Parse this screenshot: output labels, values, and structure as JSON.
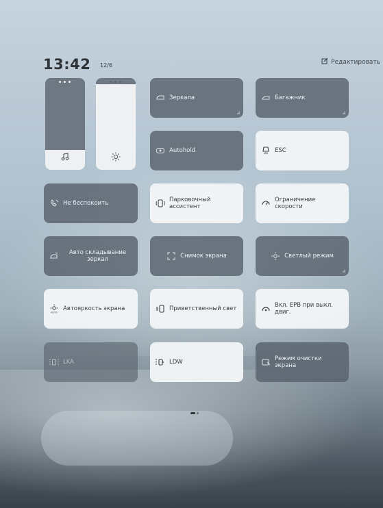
{
  "status": {
    "time": "13:42",
    "date": "12/6"
  },
  "header": {
    "edit_label": "Редактировать"
  },
  "sliders": {
    "volume": {
      "dots": "•••",
      "level": 0.22,
      "icon": "music-note-icon"
    },
    "brightness": {
      "dots": "•••",
      "level": 0.93,
      "icon": "sun-icon"
    }
  },
  "tiles": {
    "mirrors": "Зеркала",
    "trunk": "Багажник",
    "autohold": "Autohold",
    "esc": "ESC",
    "dnd": "Не беспокоить",
    "parking": "Парковочный ассистент",
    "speed_limit": "Ограничение скорости",
    "auto_fold": "Авто складывание зеркал",
    "screenshot": "Снимок экрана",
    "light_mode": "Светлый режим",
    "auto_brightness": "Автояркость экрана",
    "welcome_light": "Приветственный свет",
    "epb": "Вкл. EPB при выкл. двиг.",
    "lka": "LKA",
    "ldw": "LDW",
    "screen_clean": "Режим очистки экрана"
  },
  "colors": {
    "dark_tile": "#58626c",
    "light_tile": "#f3f5f7"
  }
}
